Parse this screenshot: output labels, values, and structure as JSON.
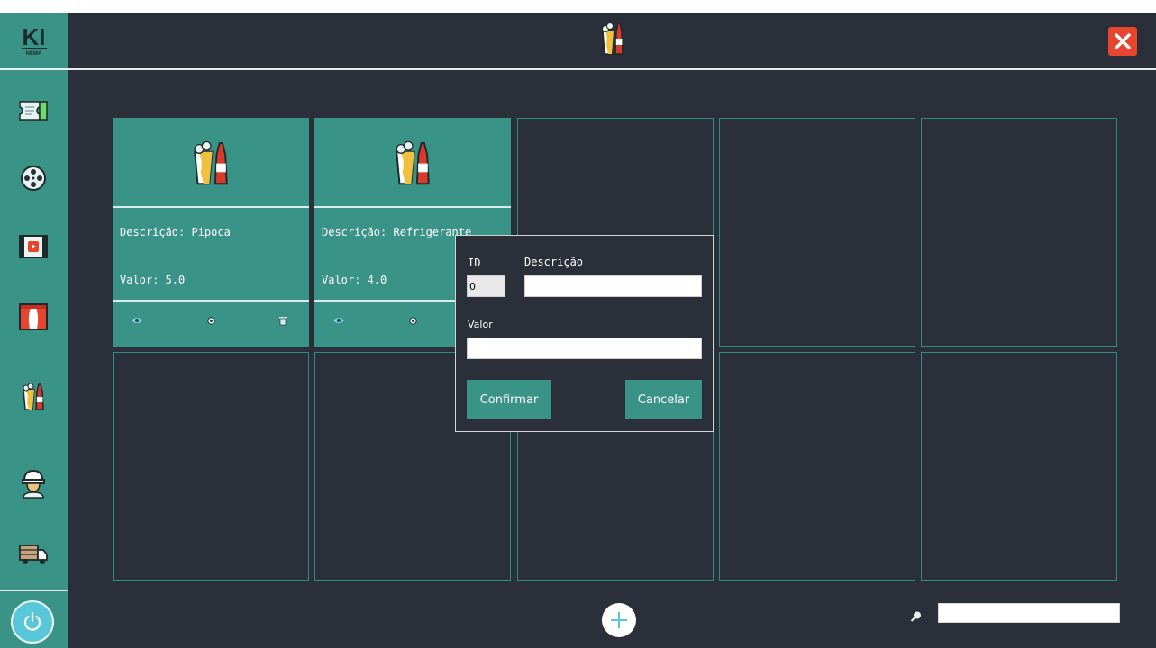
{
  "app": {
    "logo_text": "KI",
    "logo_sub": "NEMA"
  },
  "sidebar": {
    "items": [
      {
        "icon": "ticket-icon"
      },
      {
        "icon": "film-reel-icon"
      },
      {
        "icon": "video-play-icon"
      },
      {
        "icon": "theater-curtain-icon"
      },
      {
        "icon": "snacks-icon"
      },
      {
        "icon": "worker-icon"
      },
      {
        "icon": "truck-icon"
      }
    ],
    "power_icon": "power-icon"
  },
  "header": {
    "icon": "snacks-icon",
    "close_icon": "close-icon"
  },
  "products": [
    {
      "desc": "Descrição: Pipoca",
      "valor": "Valor: 5.0"
    },
    {
      "desc": "Descrição: Refrigerante",
      "valor": "Valor: 4.0"
    }
  ],
  "search": {
    "value": ""
  },
  "dialog": {
    "id_label": "ID",
    "desc_label": "Descrição",
    "id_value": "0",
    "desc_value": "",
    "valor_label": "Valor",
    "valor_value": "",
    "confirm_label": "Confirmar",
    "cancel_label": "Cancelar"
  },
  "colors": {
    "background": "#2b2f3a",
    "accent": "#3a9387",
    "close": "#e8452f",
    "power": "#58c7d9"
  }
}
